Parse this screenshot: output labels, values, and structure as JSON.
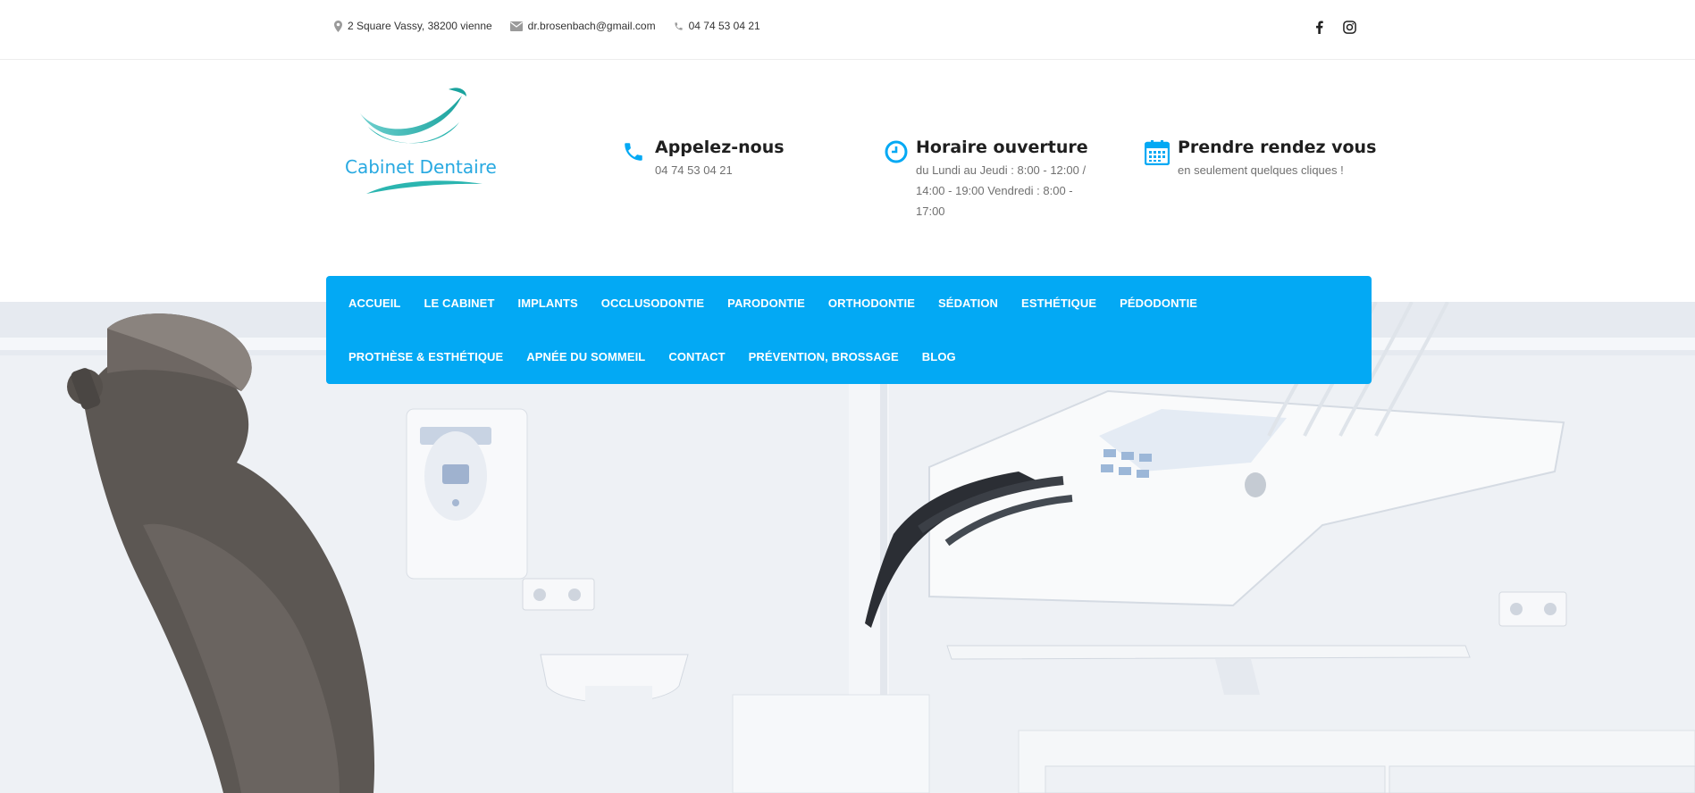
{
  "topbar": {
    "address": "2 Square Vassy, 38200 vienne",
    "email": "dr.brosenbach@gmail.com",
    "phone": "04 74 53 04 21",
    "social": [
      "facebook-icon",
      "instagram-icon"
    ]
  },
  "logo": {
    "text": "Cabinet Dentaire"
  },
  "info": {
    "call": {
      "title": "Appelez-nous",
      "text": "04 74 53 04 21",
      "icon": "phone-icon"
    },
    "hours": {
      "title": "Horaire ouverture",
      "text": "du Lundi au Jeudi : 8:00 - 12:00 / 14:00 - 19:00 Vendredi : 8:00 - 17:00",
      "icon": "clock-icon"
    },
    "appointment": {
      "title": "Prendre rendez vous",
      "text": "en seulement quelques cliques !",
      "icon": "calendar-icon"
    }
  },
  "nav": {
    "row1": [
      "ACCUEIL",
      "LE CABINET",
      "IMPLANTS",
      "OCCLUSODONTIE",
      "PARODONTIE",
      "ORTHODONTIE",
      "SÉDATION",
      "ESTHÉTIQUE",
      "PÉDODONTIE"
    ],
    "row2": [
      "PROTHÈSE & ESTHÉTIQUE",
      "APNÉE DU SOMMEIL",
      "CONTACT",
      "PRÉVENTION, BROSSAGE",
      "BLOG"
    ]
  },
  "colors": {
    "accent": "#03a9f4",
    "logo_teal": "#2bb5b0",
    "logo_blue": "#28a9e1"
  }
}
